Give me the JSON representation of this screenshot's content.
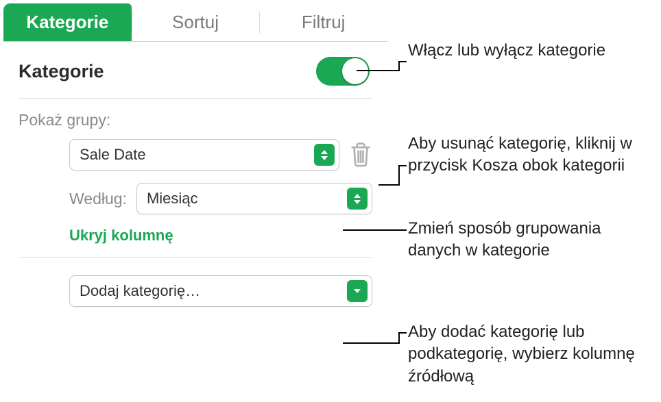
{
  "tabs": {
    "categories": "Kategorie",
    "sort": "Sortuj",
    "filter": "Filtruj"
  },
  "header": {
    "title": "Kategorie"
  },
  "groups": {
    "label": "Pokaż grupy:",
    "source_value": "Sale Date",
    "by_label": "Według:",
    "by_value": "Miesiąc",
    "hide_column": "Ukryj kolumnę"
  },
  "add": {
    "label": "Dodaj kategorię…"
  },
  "callouts": {
    "toggle": "Włącz lub wyłącz kategorie",
    "trash": "Aby usunąć kategorię, kliknij w przycisk Kosza obok kategorii",
    "by": "Zmień sposób grupowania danych w kategorie",
    "add": "Aby dodać kategorię lub podkategorię, wybierz kolumnę źródłową"
  }
}
